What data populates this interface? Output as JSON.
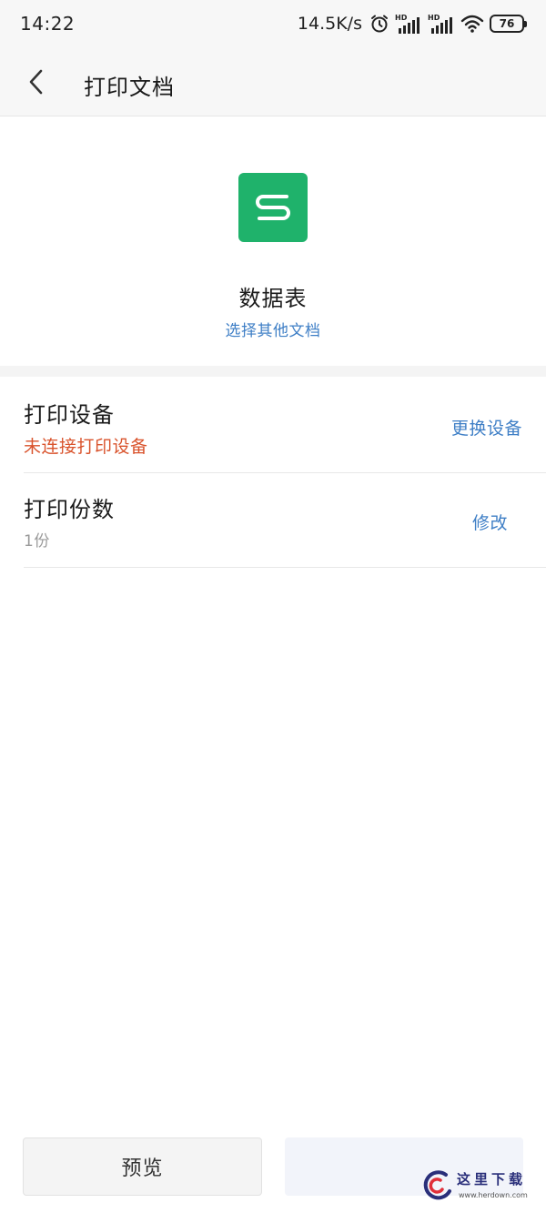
{
  "status_bar": {
    "time": "14:22",
    "network_speed": "14.5K/s",
    "battery": "76",
    "icons": [
      "alarm-icon",
      "hd-signal-icon",
      "hd-signal-icon",
      "wifi-icon",
      "battery-icon"
    ]
  },
  "header": {
    "back_icon": "chevron-left-icon",
    "title": "打印文档"
  },
  "document": {
    "icon": "wps-spreadsheet-icon",
    "icon_color": "#1fb26b",
    "icon_letter": "S",
    "name": "数据表",
    "change_link": "选择其他文档"
  },
  "settings": {
    "device": {
      "title": "打印设备",
      "status": "未连接打印设备",
      "action": "更换设备"
    },
    "copies": {
      "title": "打印份数",
      "value": "1份",
      "action": "修改"
    }
  },
  "footer": {
    "preview_label": "预览",
    "print_label": ""
  },
  "watermark": {
    "text": "这里下载",
    "url": "www.herdown.com"
  },
  "colors": {
    "accent_link": "#3f7fc6",
    "error": "#d9532c",
    "muted": "#9a9a9a"
  }
}
